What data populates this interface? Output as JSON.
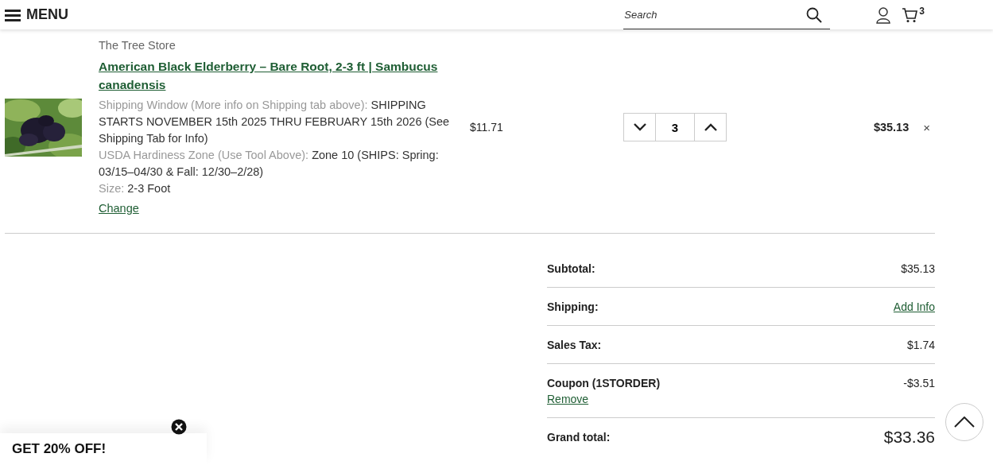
{
  "header": {
    "menu_label": "MENU",
    "search": {
      "placeholder": "Search"
    },
    "cart_count": "3"
  },
  "cart_item": {
    "brand": "The Tree Store",
    "title": "American Black Elderberry – Bare Root, 2-3 ft | Sambucus canadensis",
    "details": [
      {
        "label": "Shipping Window (More info on Shipping tab above):",
        "value": "SHIPPING STARTS NOVEMBER 15th 2025 THRU FEBRUARY 15th 2026 (See Shipping Tab for Info)"
      },
      {
        "label": "USDA Hardiness Zone (Use Tool Above):",
        "value": "Zone 10 (SHIPS: Spring: 03/15–04/30 & Fall: 12/30–2/28)"
      },
      {
        "label": "Size:",
        "value": "2-3 Foot"
      }
    ],
    "change_link": "Change",
    "unit_price": "$11.71",
    "quantity": "3",
    "line_total": "$35.13",
    "remove_glyph": "×"
  },
  "summary": [
    {
      "kind": "amount",
      "label": "Subtotal:",
      "value": "$35.13"
    },
    {
      "kind": "link",
      "label": "Shipping:",
      "value": "Add Info"
    },
    {
      "kind": "amount",
      "label": "Sales Tax:",
      "value": "$1.74"
    },
    {
      "kind": "coupon",
      "label": "Coupon (1STORDER)",
      "value": "-$3.51",
      "action": "Remove"
    },
    {
      "kind": "total",
      "label": "Grand total:",
      "value": "$33.36"
    }
  ],
  "promo": {
    "text": "GET 20% OFF!"
  }
}
